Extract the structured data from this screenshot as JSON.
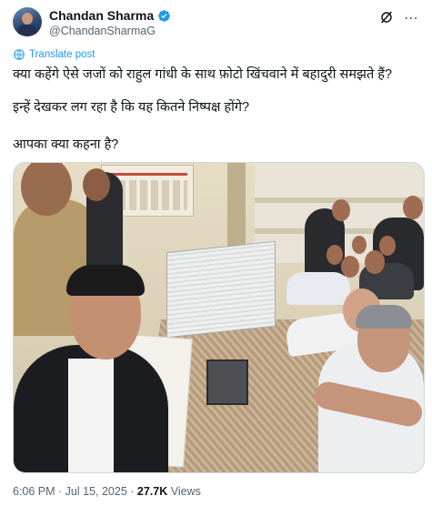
{
  "author": {
    "name": "Chandan Sharma",
    "handle": "@ChandanSharmaG",
    "verified": true,
    "avatar_icon": "user-avatar"
  },
  "header_icons": [
    "grok-icon",
    "more-icon"
  ],
  "translate_label": "Translate post",
  "post_lines": [
    "क्या कहेंगे ऐसे जजों को राहुल गांधी के साथ फ़ोटो खिंचवाने में बहादुरी समझते हैं?",
    "इन्हें देखकर लग रहा है कि यह कितने निष्पक्ष होंगे?",
    "आपका क्या कहना है?"
  ],
  "meta": {
    "time": "6:06 PM",
    "separator": " · ",
    "date": "Jul 15, 2025",
    "views_count": "27.7K",
    "views_label": "Views"
  },
  "colors": {
    "text": "#0f1419",
    "muted": "#536471",
    "accent": "#1d9bf0"
  }
}
